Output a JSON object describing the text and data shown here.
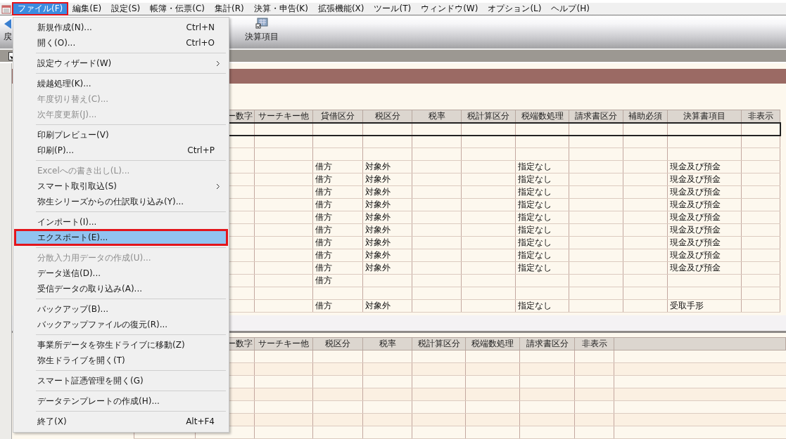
{
  "menubar": [
    {
      "label": "ファイル(F)",
      "selected": true
    },
    {
      "label": "編集(E)",
      "selected": false
    },
    {
      "label": "設定(S)",
      "selected": false
    },
    {
      "label": "帳簿・伝票(C)",
      "selected": false
    },
    {
      "label": "集計(R)",
      "selected": false
    },
    {
      "label": "決算・申告(K)",
      "selected": false
    },
    {
      "label": "拡張機能(X)",
      "selected": false
    },
    {
      "label": "ツール(T)",
      "selected": false
    },
    {
      "label": "ウィンドウ(W)",
      "selected": false
    },
    {
      "label": "オプション(L)",
      "selected": false
    },
    {
      "label": "ヘルプ(H)",
      "selected": false
    }
  ],
  "toolbar": [
    {
      "label": "戻",
      "kind": "back"
    },
    {
      "label": "決算項目",
      "kind": "statement"
    }
  ],
  "filter_checkbox": {
    "checked": true
  },
  "file_menu": [
    {
      "kind": "item",
      "label": "新規作成(N)...",
      "shortcut": "Ctrl+N",
      "submenu": false,
      "disabled": false,
      "selected": false
    },
    {
      "kind": "item",
      "label": "開く(O)...",
      "shortcut": "Ctrl+O",
      "submenu": false,
      "disabled": false,
      "selected": false
    },
    {
      "kind": "separator"
    },
    {
      "kind": "item",
      "label": "設定ウィザード(W)",
      "submenu": true,
      "disabled": false,
      "selected": false
    },
    {
      "kind": "separator"
    },
    {
      "kind": "item",
      "label": "繰越処理(K)...",
      "submenu": false,
      "disabled": false,
      "selected": false
    },
    {
      "kind": "item",
      "label": "年度切り替え(C)...",
      "submenu": false,
      "disabled": true,
      "selected": false
    },
    {
      "kind": "item",
      "label": "次年度更新(J)...",
      "submenu": false,
      "disabled": true,
      "selected": false
    },
    {
      "kind": "separator"
    },
    {
      "kind": "item",
      "label": "印刷プレビュー(V)",
      "submenu": false,
      "disabled": false,
      "selected": false
    },
    {
      "kind": "item",
      "label": "印刷(P)...",
      "shortcut": "Ctrl+P",
      "submenu": false,
      "disabled": false,
      "selected": false
    },
    {
      "kind": "separator"
    },
    {
      "kind": "item",
      "label": "Excelへの書き出し(L)...",
      "submenu": false,
      "disabled": true,
      "selected": false
    },
    {
      "kind": "item",
      "label": "スマート取引取込(S)",
      "submenu": true,
      "disabled": false,
      "selected": false
    },
    {
      "kind": "item",
      "label": "弥生シリーズからの仕訳取り込み(Y)...",
      "submenu": false,
      "disabled": false,
      "selected": false
    },
    {
      "kind": "separator"
    },
    {
      "kind": "item",
      "label": "インポート(I)...",
      "submenu": false,
      "disabled": false,
      "selected": false
    },
    {
      "kind": "item",
      "label": "エクスポート(E)...",
      "submenu": false,
      "disabled": false,
      "selected": true
    },
    {
      "kind": "separator"
    },
    {
      "kind": "item",
      "label": "分散入力用データの作成(U)...",
      "submenu": false,
      "disabled": true,
      "selected": false
    },
    {
      "kind": "item",
      "label": "データ送信(D)...",
      "submenu": false,
      "disabled": false,
      "selected": false
    },
    {
      "kind": "item",
      "label": "受信データの取り込み(A)...",
      "submenu": false,
      "disabled": false,
      "selected": false
    },
    {
      "kind": "separator"
    },
    {
      "kind": "item",
      "label": "バックアップ(B)...",
      "submenu": false,
      "disabled": false,
      "selected": false
    },
    {
      "kind": "item",
      "label": "バックアップファイルの復元(R)...",
      "submenu": false,
      "disabled": false,
      "selected": false
    },
    {
      "kind": "separator"
    },
    {
      "kind": "item",
      "label": "事業所データを弥生ドライブに移動(Z)",
      "submenu": false,
      "disabled": false,
      "selected": false
    },
    {
      "kind": "item",
      "label": "弥生ドライブを開く(T)",
      "submenu": false,
      "disabled": false,
      "selected": false
    },
    {
      "kind": "separator"
    },
    {
      "kind": "item",
      "label": "スマート証憑管理を開く(G)",
      "submenu": false,
      "disabled": false,
      "selected": false
    },
    {
      "kind": "separator"
    },
    {
      "kind": "item",
      "label": "データテンプレートの作成(H)...",
      "submenu": false,
      "disabled": false,
      "selected": false
    },
    {
      "kind": "separator"
    },
    {
      "kind": "item",
      "label": "終了(X)",
      "shortcut": "Alt+F4",
      "submenu": false,
      "disabled": false,
      "selected": false
    }
  ],
  "upper_table": {
    "columns": [
      "ー数字",
      "サーチキー他",
      "貸借区分",
      "税区分",
      "税率",
      "税計算区分",
      "税端数処理",
      "請求書区分",
      "補助必須",
      "決算書項目",
      "非表示"
    ],
    "rows": [
      {
        "selected": true
      },
      {
        "selected": false
      },
      {
        "selected": false
      },
      {
        "selected": false,
        "debit_credit": "借方",
        "tax_category": "対象外",
        "tax_rounding": "指定なし",
        "statement_item": "現金及び預金"
      },
      {
        "selected": false,
        "debit_credit": "借方",
        "tax_category": "対象外",
        "tax_rounding": "指定なし",
        "statement_item": "現金及び預金"
      },
      {
        "selected": false,
        "debit_credit": "借方",
        "tax_category": "対象外",
        "tax_rounding": "指定なし",
        "statement_item": "現金及び預金"
      },
      {
        "selected": false,
        "debit_credit": "借方",
        "tax_category": "対象外",
        "tax_rounding": "指定なし",
        "statement_item": "現金及び預金"
      },
      {
        "selected": false,
        "debit_credit": "借方",
        "tax_category": "対象外",
        "tax_rounding": "指定なし",
        "statement_item": "現金及び預金"
      },
      {
        "selected": false,
        "debit_credit": "借方",
        "tax_category": "対象外",
        "tax_rounding": "指定なし",
        "statement_item": "現金及び預金"
      },
      {
        "selected": false,
        "debit_credit": "借方",
        "tax_category": "対象外",
        "tax_rounding": "指定なし",
        "statement_item": "現金及び預金"
      },
      {
        "selected": false,
        "debit_credit": "借方",
        "tax_category": "対象外",
        "tax_rounding": "指定なし",
        "statement_item": "現金及び預金"
      },
      {
        "selected": false,
        "debit_credit": "借方",
        "tax_category": "対象外",
        "tax_rounding": "指定なし",
        "statement_item": "現金及び預金"
      },
      {
        "selected": false,
        "debit_credit": "借方"
      },
      {
        "selected": false
      },
      {
        "selected": false,
        "debit_credit": "借方",
        "tax_category": "対象外",
        "tax_rounding": "指定なし",
        "statement_item": "受取手形"
      }
    ]
  },
  "lower_table": {
    "columns": [
      "ー数字",
      "サーチキー他",
      "税区分",
      "税率",
      "税計算区分",
      "税端数処理",
      "請求書区分",
      "非表示"
    ]
  }
}
